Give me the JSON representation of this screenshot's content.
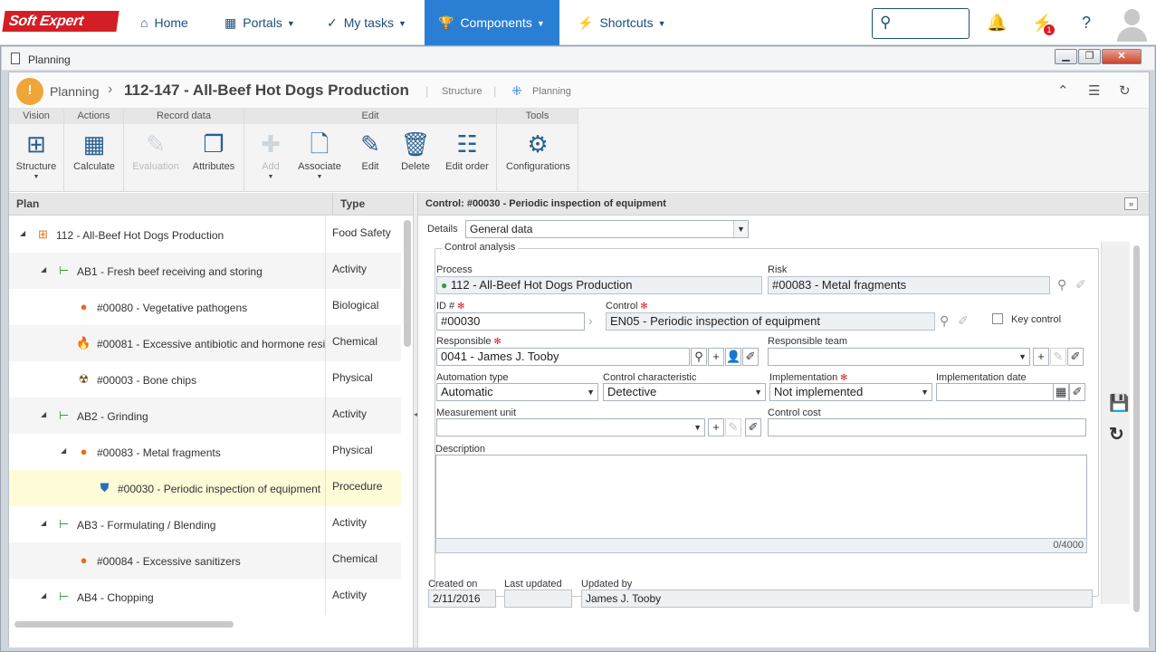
{
  "nav": {
    "logo": "Soft Expert",
    "items": [
      {
        "label": "Home",
        "icon": "home-icon"
      },
      {
        "label": "Portals",
        "icon": "portals-icon"
      },
      {
        "label": "My tasks",
        "icon": "check-icon"
      },
      {
        "label": "Components",
        "icon": "trophy-icon"
      },
      {
        "label": "Shortcuts",
        "icon": "bolt-icon"
      }
    ],
    "notification_badge": "1"
  },
  "window": {
    "title": "Planning",
    "btn_minimize": "▁",
    "btn_restore": "❐",
    "btn_close": "✕"
  },
  "breadcrumb": {
    "section": "Planning",
    "title": "112-147 - All-Beef Hot Dogs Production",
    "structure": "Structure",
    "planning": "Planning"
  },
  "ribbon": {
    "groups": [
      "Vision",
      "Actions",
      "Record data",
      "Edit",
      "Tools"
    ],
    "tools": {
      "structure": "Structure",
      "calculate": "Calculate",
      "evaluation": "Evaluation",
      "attributes": "Attributes",
      "add": "Add",
      "associate": "Associate",
      "edit": "Edit",
      "delete": "Delete",
      "edit_order": "Edit order",
      "configurations": "Configurations"
    }
  },
  "plan": {
    "headers": {
      "plan": "Plan",
      "type": "Type"
    },
    "rows": [
      {
        "name": "112 - All-Beef Hot Dogs Production",
        "type": "Food Safety"
      },
      {
        "name": "AB1 - Fresh beef receiving and storing",
        "type": "Activity"
      },
      {
        "name": "#00080 - Vegetative pathogens",
        "type": "Biological"
      },
      {
        "name": "#00081 - Excessive antibiotic and hormone resi",
        "type": "Chemical"
      },
      {
        "name": "#00003 - Bone chips",
        "type": "Physical"
      },
      {
        "name": "AB2 - Grinding",
        "type": "Activity"
      },
      {
        "name": "#00083 - Metal fragments",
        "type": "Physical"
      },
      {
        "name": "#00030 - Periodic inspection of equipment",
        "type": "Procedure"
      },
      {
        "name": "AB3 - Formulating / Blending",
        "type": "Activity"
      },
      {
        "name": "#00084 - Excessive sanitizers",
        "type": "Chemical"
      },
      {
        "name": "AB4 - Chopping",
        "type": "Activity"
      }
    ]
  },
  "detail": {
    "header": "Control: #00030 - Periodic inspection of equipment",
    "details_label": "Details",
    "details_value": "General data",
    "section": "Control analysis",
    "process_label": "Process",
    "process_value": "112 - All-Beef Hot Dogs Production",
    "risk_label": "Risk",
    "risk_value": "#00083 - Metal fragments",
    "id_label": "ID #",
    "id_value": "#00030",
    "control_label": "Control",
    "control_value": "EN05 - Periodic inspection of equipment",
    "key_control_label": "Key control",
    "responsible_label": "Responsible",
    "responsible_value": "0041 - James J. Tooby",
    "responsible_team_label": "Responsible team",
    "responsible_team_value": "",
    "automation_label": "Automation type",
    "automation_value": "Automatic",
    "characteristic_label": "Control characteristic",
    "characteristic_value": "Detective",
    "implementation_label": "Implementation",
    "implementation_value": "Not implemented",
    "impl_date_label": "Implementation date",
    "impl_date_value": "",
    "measurement_label": "Measurement unit",
    "measurement_value": "",
    "cost_label": "Control cost",
    "cost_value": "",
    "description_label": "Description",
    "description_counter": "0/4000",
    "created_label": "Created on",
    "created_value": "2/11/2016",
    "updated_label": "Last updated",
    "updated_value": "",
    "updated_by_label": "Updated by",
    "updated_by_value": "James J. Tooby"
  }
}
